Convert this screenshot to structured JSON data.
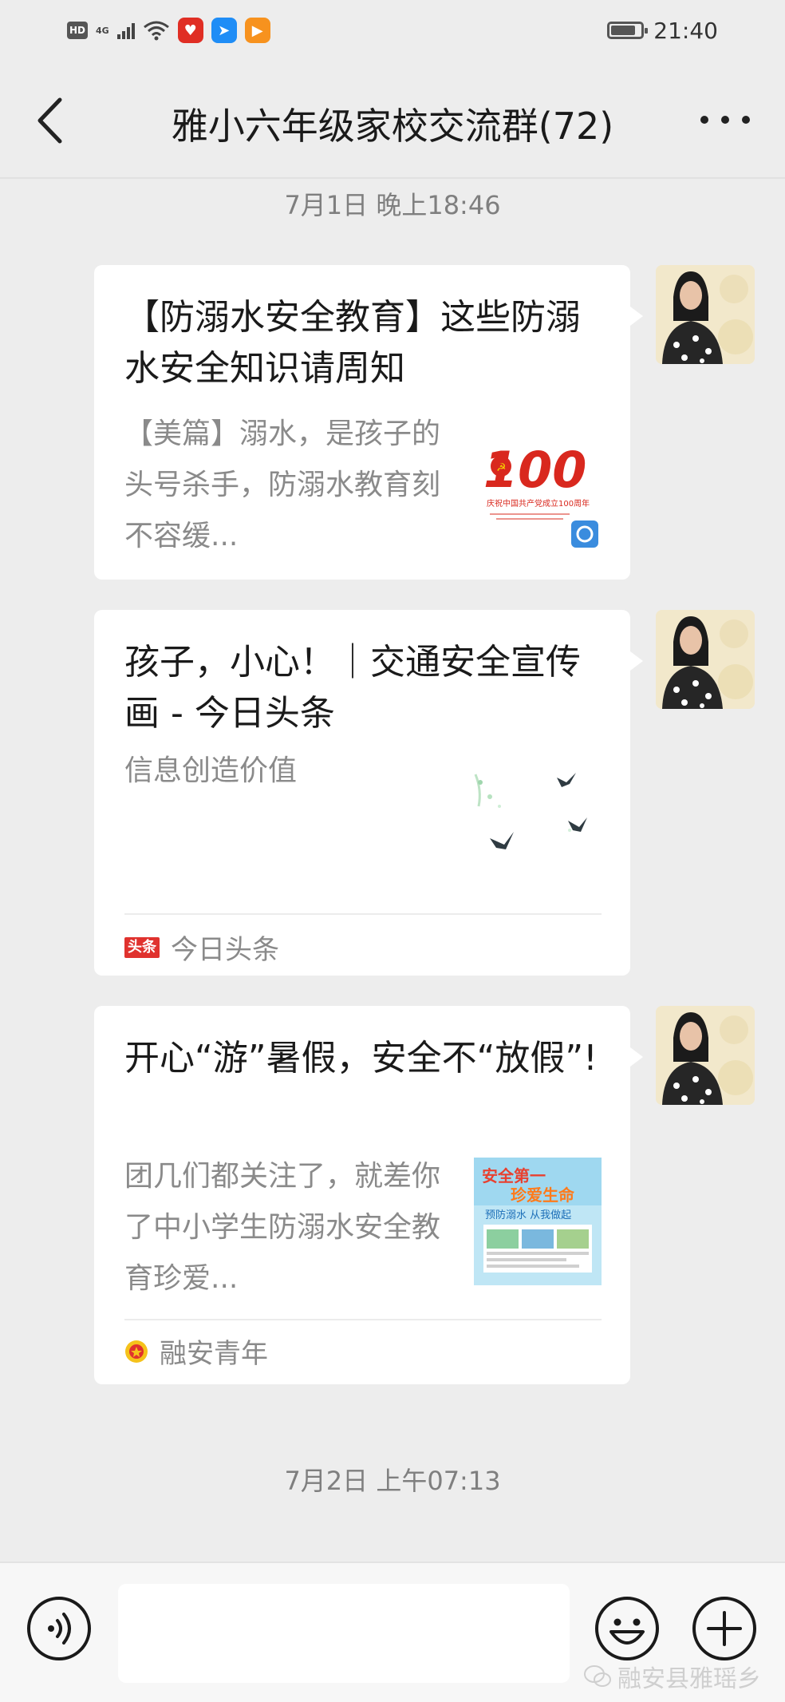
{
  "status_bar": {
    "hd": "HD",
    "network": "4G",
    "time": "21:40"
  },
  "header": {
    "title": "雅小六年级家校交流群(72)"
  },
  "timestamps": {
    "first": "7月1日 晚上18:46",
    "second": "7月2日 上午07:13"
  },
  "messages": [
    {
      "title": "【防溺水安全教育】这些防溺水安全知识请周知",
      "description": "【美篇】溺水，是孩子的头号杀手，防溺水教育刻不容缓...",
      "thumbnail_icon": "party-100-anniversary-thumbnail",
      "thumbnail_caption": "庆祝中国共产党成立100周年"
    },
    {
      "title": "孩子，小心！｜交通安全宣传画 - 今日头条",
      "description": "信息创造价值",
      "source_badge": "头条",
      "source": "今日头条",
      "thumbnail_icon": "swallows-thumbnail"
    },
    {
      "title": "开心“游”暑假，安全不“放假”!",
      "description": "团几们都关注了，就差你了中小学生防溺水安全教育珍爱...",
      "source": "融安青年",
      "source_icon": "youth-league-icon",
      "thumbnail_icon": "safety-poster-thumbnail",
      "thumbnail_lines": [
        "安全第一",
        "珍爱生命",
        "预防溺水 从我做起"
      ]
    }
  ],
  "watermark": "融安县雅瑶乡",
  "colors": {
    "background": "#ededed",
    "card": "#ffffff",
    "toutiao_red": "#e0322e"
  }
}
